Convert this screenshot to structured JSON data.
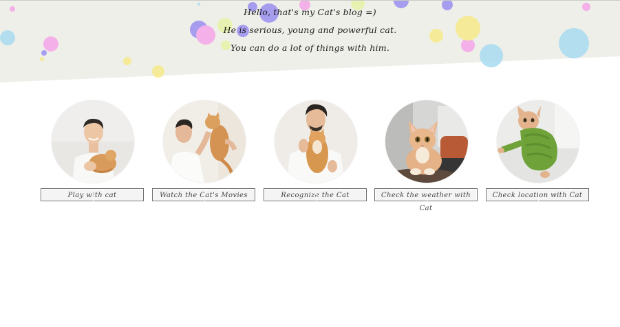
{
  "intro": {
    "lines": [
      "Hello, that's my Cat's blog =)",
      "He is serious, young and powerful cat.",
      "You can do a lot of things with him."
    ]
  },
  "colors": {
    "header_bg": "#efefea",
    "bubble_palette": [
      "#f5a6e8",
      "#9a8ff0",
      "#a8dcf2",
      "#f6ea8a",
      "#e7f3a6"
    ]
  },
  "cards": [
    {
      "photo": "man-holding-cat-photo",
      "label": "Play with cat"
    },
    {
      "photo": "man-lifting-cat-photo",
      "label": "Watch the Cat's Movies"
    },
    {
      "photo": "man-hugging-cat-photo",
      "label": "Recognize the Cat"
    },
    {
      "photo": "cat-on-chair-photo",
      "label": "Check the weather with Cat"
    },
    {
      "photo": "cat-in-green-sweater-photo",
      "label": "Check location with Cat"
    }
  ]
}
